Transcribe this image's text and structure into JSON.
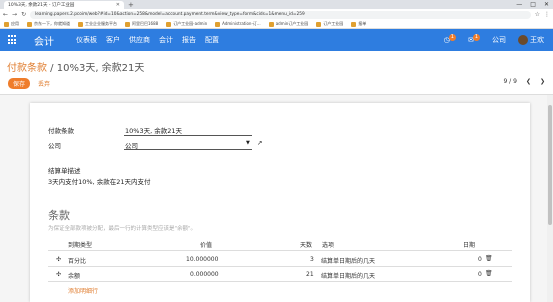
{
  "browser": {
    "tab_title": "10%3天, 余款21天 - 订户工业园",
    "url": "learning.papers.2.pcoim/web?#id=10&action=258&model=account.payment.term&view_type=form&cids=1&menu_id=259",
    "bookmarks": [
      "应用",
      "京东一下，你就知道",
      "工业企业服务平台",
      "阿里巴巴1688",
      "订户工业园-admin",
      "Administration-订...",
      "admin订户工业园",
      "订户工业园",
      "报单"
    ],
    "window_controls": [
      "—",
      "□",
      "✕"
    ]
  },
  "navbar": {
    "brand": "会计",
    "menu": [
      "仪表板",
      "客户",
      "供应商",
      "会计",
      "报告",
      "配置"
    ],
    "activity_count": "1",
    "chat_count": "1",
    "company": "公司",
    "user": "王欢"
  },
  "control_panel": {
    "breadcrumb_parent": "付款条款",
    "breadcrumb_sep": " / ",
    "breadcrumb_current": "10%3天, 余款21天",
    "save_label": "保存",
    "discard_label": "丢弃",
    "pager": "9 / 9"
  },
  "form": {
    "name_label": "付款条款",
    "name_value": "10%3天, 余款21天",
    "company_label": "公司",
    "company_value": "公司",
    "desc_label": "结算单描述",
    "desc_value": "3天内支付10%, 余款在21天内支付",
    "section_title": "条款",
    "section_hint": "为保证全部款项被分配，最后一行的计算类型应该是\"余额\"。",
    "table": {
      "headers": [
        "到期类型",
        "价值",
        "天数",
        "选项",
        "日期"
      ],
      "rows": [
        {
          "type": "百分比",
          "value": "10.000000",
          "days": "3",
          "option": "结算单日期后的几天",
          "date": "0"
        },
        {
          "type": "余额",
          "value": "0.000000",
          "days": "21",
          "option": "结算单日期后的几天",
          "date": "0"
        }
      ],
      "add_line": "添加明细行"
    }
  }
}
